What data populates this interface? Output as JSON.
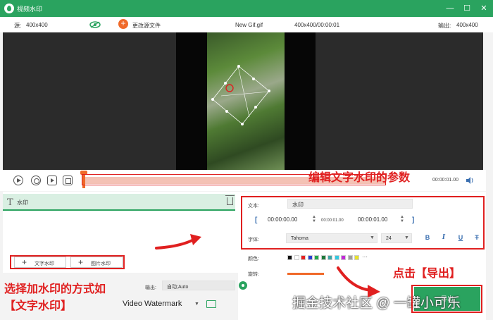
{
  "window": {
    "title": "视频水印",
    "minimize": "—",
    "maximize": "☐",
    "close": "✕"
  },
  "infobar": {
    "source_label": "源:",
    "source_size": "400x400",
    "change_source": "更改源文件",
    "filename": "New Gif.gif",
    "info": "400x400/00:00:01",
    "output_label": "输出:",
    "output_size": "400x400"
  },
  "timeline": {
    "end_time": "00:00:01.00"
  },
  "watermark_list": {
    "items": [
      {
        "label": "水印"
      }
    ],
    "add_text": "文字水印",
    "add_image": "图片水印"
  },
  "properties": {
    "text_label": "文本:",
    "text_value": "水印",
    "start_time": "00:00:00.00",
    "duration": "00:00:01.00",
    "end_time": "00:00:01.00",
    "bracket_open": "[",
    "bracket_close": "]",
    "font_label": "字体:",
    "font_value": "Tahoma",
    "size_value": "24",
    "bold": "B",
    "italic": "I",
    "underline": "U",
    "strike": "T",
    "color_label": "颜色:",
    "more": "···",
    "rotate_label": "旋转:",
    "colors": [
      "#111111",
      "#ffffff",
      "#e62020",
      "#2a3fd0",
      "#23a84a",
      "#1e7a3a",
      "#3fa5a5",
      "#33c8e0",
      "#c22ad8",
      "#9e9e9e",
      "#e8e22a"
    ]
  },
  "bottom": {
    "output_label": "输出:",
    "output_value": "自动;Auto",
    "format_value": "Video Watermark",
    "export_label": "导出"
  },
  "annotations": {
    "edit_params": "编辑文字水印的参数",
    "choose_method_1": "选择加水印的方式如",
    "choose_method_2": "【文字水印】",
    "click_export": "点击【导出】"
  },
  "watermark_text": "掘金技术社区 @ 一罐小可乐"
}
